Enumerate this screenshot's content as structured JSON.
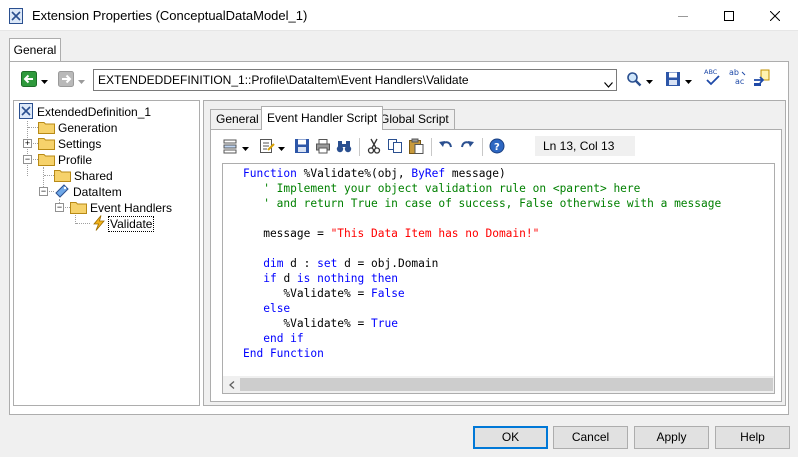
{
  "window": {
    "title": "Extension Properties (ConceptualDataModel_1)"
  },
  "outer_tabs": [
    {
      "label": "General"
    }
  ],
  "toolbar": {
    "path_value": "EXTENDEDDEFINITION_1::Profile\\DataItem\\Event Handlers\\Validate"
  },
  "tree": {
    "items": [
      {
        "label": "ExtendedDefinition_1",
        "icon": "extension-file-icon"
      },
      {
        "label": "Generation",
        "icon": "folder-icon"
      },
      {
        "label": "Settings",
        "icon": "folder-icon"
      },
      {
        "label": "Profile",
        "icon": "folder-icon"
      },
      {
        "label": "Shared",
        "icon": "folder-icon"
      },
      {
        "label": "DataItem",
        "icon": "data-item-icon"
      },
      {
        "label": "Event Handlers",
        "icon": "folder-icon"
      },
      {
        "label": "Validate",
        "icon": "lightning-icon"
      }
    ]
  },
  "inner_tabs": [
    {
      "label": "General"
    },
    {
      "label": "Event Handler Script"
    },
    {
      "label": "Global Script"
    }
  ],
  "editor": {
    "status": "Ln 13, Col 13",
    "lines": [
      {
        "text": "Function %Validate%(obj, ByRef message)"
      },
      {
        "text": "   ' Implement your object validation rule on <parent> here"
      },
      {
        "text": "   ' and return True in case of success, False otherwise with a message"
      },
      {
        "text": ""
      },
      {
        "text": "   message = \"This Data Item has no Domain!\""
      },
      {
        "text": ""
      },
      {
        "text": "   dim d : set d = obj.Domain"
      },
      {
        "text": "   if d is nothing then"
      },
      {
        "text": "      %Validate% = False"
      },
      {
        "text": "   else"
      },
      {
        "text": "      %Validate% = True"
      },
      {
        "text": "   end if"
      },
      {
        "text": "End Function"
      }
    ]
  },
  "buttons": {
    "ok": "OK",
    "cancel": "Cancel",
    "apply": "Apply",
    "help": "Help"
  },
  "colors": {
    "keyword": "#0000ff",
    "comment": "#008000",
    "string": "#ff0000",
    "focus_border": "#0078d7"
  }
}
